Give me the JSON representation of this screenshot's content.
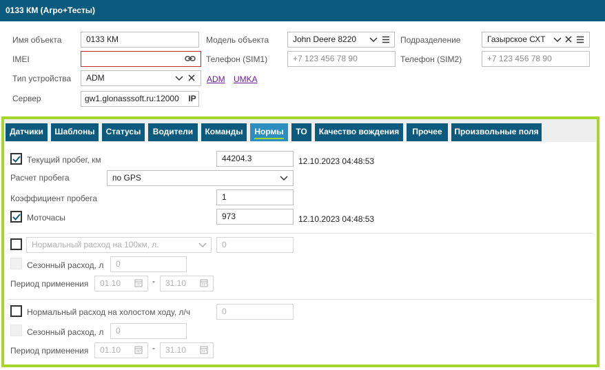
{
  "window": {
    "title": "0133 КМ (Агро+Тесты)"
  },
  "header_form": {
    "object_name": {
      "label": "Имя объекта",
      "value": "0133 КМ"
    },
    "object_model": {
      "label": "Модель объекта",
      "value": "John Deere 8220"
    },
    "division": {
      "label": "Подразделение",
      "value": "Газырское СХТ"
    },
    "imei": {
      "label": "IMEI",
      "value": ""
    },
    "phone1": {
      "label": "Телефон (SIM1)",
      "placeholder": "+7 123 456 78 90"
    },
    "phone2": {
      "label": "Телефон (SIM2)",
      "placeholder": "+7 123 456 78 90"
    },
    "device_type": {
      "label": "Тип устройства",
      "value": "ADM",
      "links": [
        "ADM",
        "UMKA"
      ]
    },
    "server": {
      "label": "Сервер",
      "value": "gw1.glonasssoft.ru:12000",
      "suffix": "IP"
    }
  },
  "tabs": [
    {
      "label": "Датчики"
    },
    {
      "label": "Шаблоны"
    },
    {
      "label": "Статусы"
    },
    {
      "label": "Водители"
    },
    {
      "label": "Команды"
    },
    {
      "label": "Нормы",
      "active": true
    },
    {
      "label": "ТО"
    },
    {
      "label": "Качество вождения"
    },
    {
      "label": "Прочее"
    },
    {
      "label": "Произвольные поля"
    }
  ],
  "norms": {
    "mileage": {
      "label": "Текущий пробег, км",
      "checked": true,
      "value": "44204.3",
      "timestamp": "12.10.2023 04:48:53"
    },
    "mileage_calc": {
      "label": "Расчет пробега",
      "value": "по GPS"
    },
    "mileage_coef": {
      "label": "Коэффициент пробега",
      "value": "1"
    },
    "engine_hours": {
      "label": "Моточасы",
      "checked": true,
      "value": "973",
      "timestamp": "12.10.2023 04:48:53"
    },
    "consumption_100km": {
      "checked": false,
      "select_placeholder": "Нормальный расход на 100км, л.",
      "value": "0",
      "seasonal_label": "Сезонный расход, л",
      "seasonal_value": "0",
      "period_label": "Период применения",
      "period_from": "01.10",
      "period_dash": "-",
      "period_to": "31.10"
    },
    "consumption_idle": {
      "checked": false,
      "label": "Нормальный расход на холостом ходу, л/ч",
      "value": "0",
      "seasonal_label": "Сезонный расход, л",
      "seasonal_value": "0",
      "period_label": "Период применения",
      "period_from": "01.10",
      "period_dash": "-",
      "period_to": "31.10"
    }
  },
  "colors": {
    "header": "#0d5a7f",
    "tab_active": "#2d8fc0",
    "accent": "#a6d62b",
    "error": "#c62828",
    "link": "#6a1b9a"
  }
}
